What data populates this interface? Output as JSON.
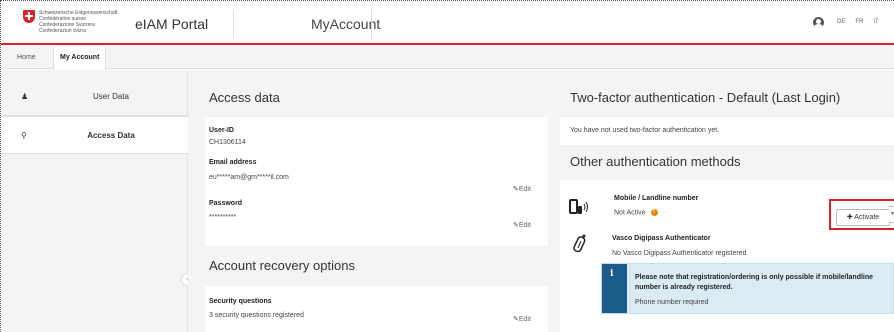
{
  "header": {
    "confederation": [
      "Schweizerische Eidgenossenschaft",
      "Confédération suisse",
      "Confederazione Svizzera",
      "Confederaziun svizra"
    ],
    "portal_title": "eIAM Portal",
    "page_title": "MyAccount",
    "languages": [
      "DE",
      "FR",
      "IT"
    ]
  },
  "breadcrumb": {
    "home": "Home",
    "current": "My Account"
  },
  "sidebar": {
    "items": [
      {
        "label": "User Data",
        "icon": "user-icon"
      },
      {
        "label": "Access Data",
        "icon": "key-icon"
      }
    ]
  },
  "access_data": {
    "title": "Access data",
    "user_id_label": "User-ID",
    "user_id_value": "CH1306114",
    "email_label": "Email address",
    "email_value": "eu*****am@gm*****il.com",
    "email_edit": "Edit",
    "password_label": "Password",
    "password_value": "**********",
    "password_edit": "Edit"
  },
  "recovery": {
    "title": "Account recovery options",
    "security_label": "Security questions",
    "security_value": "3 security questions registered",
    "security_edit": "Edit"
  },
  "two_factor": {
    "title": "Two-factor authentication - Default (Last Login)",
    "message": "You have not used two-factor authentication yet."
  },
  "other_methods": {
    "title": "Other authentication methods",
    "mobile_title": "Mobile / Landline number",
    "mobile_status": "Not Active",
    "activate_label": "Activate",
    "vasco_title": "Vasco Digipass Authenticator",
    "vasco_status": "No Vasco Digipass Authenticator registered",
    "info_text": "Please note that registration/ordering is only possible if mobile/landline number is already registered.",
    "info_sub": "Phone number required"
  },
  "colors": {
    "accent_red": "#d8232a",
    "info_blue": "#1a5d8a",
    "warning_orange": "#e8840b"
  }
}
